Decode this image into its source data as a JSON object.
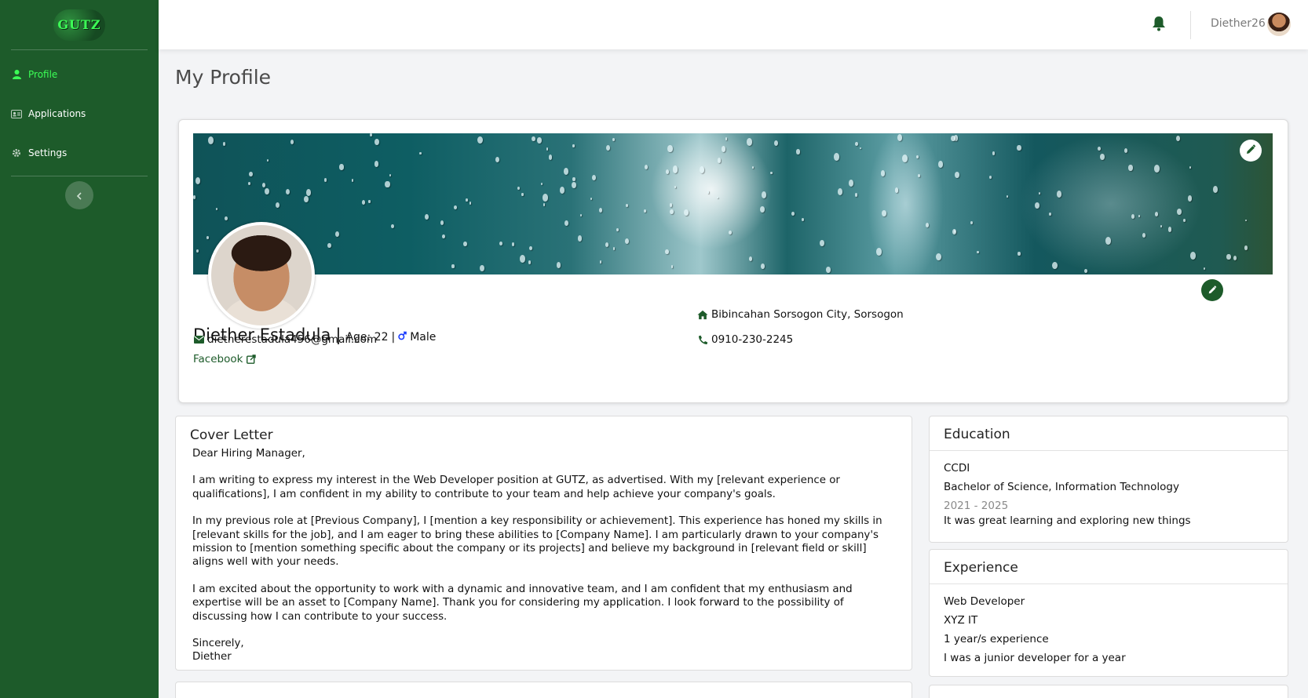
{
  "sidebar": {
    "logo_text": "GUTZ",
    "items": [
      {
        "label": "Profile",
        "icon": "user-icon",
        "active": true
      },
      {
        "label": "Applications",
        "icon": "id-card-icon",
        "active": false
      },
      {
        "label": "Settings",
        "icon": "gear-icon",
        "active": false
      }
    ],
    "collapse_icon": "chevron-left-icon"
  },
  "topbar": {
    "username": "Diether26",
    "bell_icon": "bell-icon"
  },
  "page": {
    "title": "My Profile"
  },
  "profile": {
    "name": "Diether Estadula",
    "separator": "|",
    "age": "Age: 22",
    "age_separator": "|",
    "gender": "Male",
    "email": "dietherestadula456@gmail.com",
    "facebook": "Facebook",
    "address": "Bibincahan Sorsogon City, Sorsogon",
    "phone": "0910-230-2245"
  },
  "cover_letter": {
    "title": "Cover Letter",
    "greeting": "Dear Hiring Manager,",
    "paragraphs": [
      "I am writing to express my interest in the Web Developer position at GUTZ, as advertised. With my [relevant experience or qualifications], I am confident in my ability to contribute to your team and help achieve your company's goals.",
      "In my previous role at [Previous Company], I [mention a key responsibility or achievement]. This experience has honed my skills in [relevant skills for the job], and I am eager to bring these abilities to [Company Name]. I am particularly drawn to your company's mission to [mention something specific about the company or its projects] and believe my background in [relevant field or skill] aligns well with your needs.",
      "I am excited about the opportunity to work with a dynamic and innovative team, and I am confident that my enthusiasm and expertise will be an asset to [Company Name]. Thank you for considering my application. I look forward to the possibility of discussing how I can contribute to your success."
    ],
    "closing": "Sincerely,",
    "signature": "Diether"
  },
  "education": {
    "title": "Education",
    "school": "CCDI",
    "degree": "Bachelor of Science, Information Technology",
    "years": "2021 - 2025",
    "note": "It was great learning and exploring new things"
  },
  "experience": {
    "title": "Experience",
    "position": "Web Developer",
    "company": "XYZ IT",
    "duration": "1 year/s experience",
    "note": "I was a junior developer for a year"
  },
  "colors": {
    "sidebar": "#1d5b2a",
    "active": "#3cff56",
    "accent": "#1d5b2a",
    "male": "#1a3cff"
  }
}
